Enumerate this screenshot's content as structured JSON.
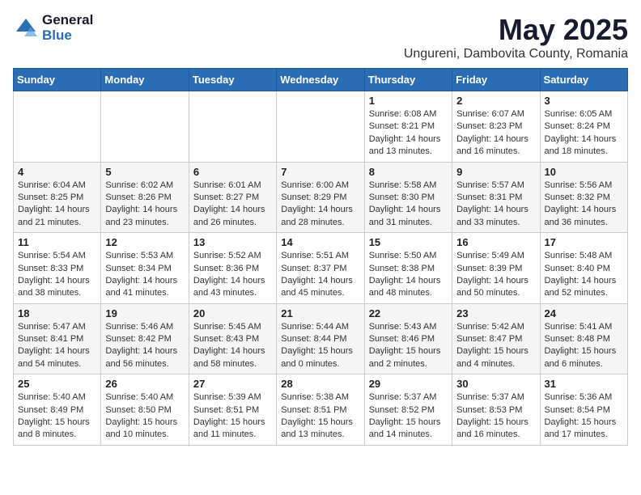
{
  "header": {
    "logo_general": "General",
    "logo_blue": "Blue",
    "month_title": "May 2025",
    "location": "Ungureni, Dambovita County, Romania"
  },
  "days_of_week": [
    "Sunday",
    "Monday",
    "Tuesday",
    "Wednesday",
    "Thursday",
    "Friday",
    "Saturday"
  ],
  "weeks": [
    [
      {
        "num": "",
        "info": ""
      },
      {
        "num": "",
        "info": ""
      },
      {
        "num": "",
        "info": ""
      },
      {
        "num": "",
        "info": ""
      },
      {
        "num": "1",
        "info": "Sunrise: 6:08 AM\nSunset: 8:21 PM\nDaylight: 14 hours\nand 13 minutes."
      },
      {
        "num": "2",
        "info": "Sunrise: 6:07 AM\nSunset: 8:23 PM\nDaylight: 14 hours\nand 16 minutes."
      },
      {
        "num": "3",
        "info": "Sunrise: 6:05 AM\nSunset: 8:24 PM\nDaylight: 14 hours\nand 18 minutes."
      }
    ],
    [
      {
        "num": "4",
        "info": "Sunrise: 6:04 AM\nSunset: 8:25 PM\nDaylight: 14 hours\nand 21 minutes."
      },
      {
        "num": "5",
        "info": "Sunrise: 6:02 AM\nSunset: 8:26 PM\nDaylight: 14 hours\nand 23 minutes."
      },
      {
        "num": "6",
        "info": "Sunrise: 6:01 AM\nSunset: 8:27 PM\nDaylight: 14 hours\nand 26 minutes."
      },
      {
        "num": "7",
        "info": "Sunrise: 6:00 AM\nSunset: 8:29 PM\nDaylight: 14 hours\nand 28 minutes."
      },
      {
        "num": "8",
        "info": "Sunrise: 5:58 AM\nSunset: 8:30 PM\nDaylight: 14 hours\nand 31 minutes."
      },
      {
        "num": "9",
        "info": "Sunrise: 5:57 AM\nSunset: 8:31 PM\nDaylight: 14 hours\nand 33 minutes."
      },
      {
        "num": "10",
        "info": "Sunrise: 5:56 AM\nSunset: 8:32 PM\nDaylight: 14 hours\nand 36 minutes."
      }
    ],
    [
      {
        "num": "11",
        "info": "Sunrise: 5:54 AM\nSunset: 8:33 PM\nDaylight: 14 hours\nand 38 minutes."
      },
      {
        "num": "12",
        "info": "Sunrise: 5:53 AM\nSunset: 8:34 PM\nDaylight: 14 hours\nand 41 minutes."
      },
      {
        "num": "13",
        "info": "Sunrise: 5:52 AM\nSunset: 8:36 PM\nDaylight: 14 hours\nand 43 minutes."
      },
      {
        "num": "14",
        "info": "Sunrise: 5:51 AM\nSunset: 8:37 PM\nDaylight: 14 hours\nand 45 minutes."
      },
      {
        "num": "15",
        "info": "Sunrise: 5:50 AM\nSunset: 8:38 PM\nDaylight: 14 hours\nand 48 minutes."
      },
      {
        "num": "16",
        "info": "Sunrise: 5:49 AM\nSunset: 8:39 PM\nDaylight: 14 hours\nand 50 minutes."
      },
      {
        "num": "17",
        "info": "Sunrise: 5:48 AM\nSunset: 8:40 PM\nDaylight: 14 hours\nand 52 minutes."
      }
    ],
    [
      {
        "num": "18",
        "info": "Sunrise: 5:47 AM\nSunset: 8:41 PM\nDaylight: 14 hours\nand 54 minutes."
      },
      {
        "num": "19",
        "info": "Sunrise: 5:46 AM\nSunset: 8:42 PM\nDaylight: 14 hours\nand 56 minutes."
      },
      {
        "num": "20",
        "info": "Sunrise: 5:45 AM\nSunset: 8:43 PM\nDaylight: 14 hours\nand 58 minutes."
      },
      {
        "num": "21",
        "info": "Sunrise: 5:44 AM\nSunset: 8:44 PM\nDaylight: 15 hours\nand 0 minutes."
      },
      {
        "num": "22",
        "info": "Sunrise: 5:43 AM\nSunset: 8:46 PM\nDaylight: 15 hours\nand 2 minutes."
      },
      {
        "num": "23",
        "info": "Sunrise: 5:42 AM\nSunset: 8:47 PM\nDaylight: 15 hours\nand 4 minutes."
      },
      {
        "num": "24",
        "info": "Sunrise: 5:41 AM\nSunset: 8:48 PM\nDaylight: 15 hours\nand 6 minutes."
      }
    ],
    [
      {
        "num": "25",
        "info": "Sunrise: 5:40 AM\nSunset: 8:49 PM\nDaylight: 15 hours\nand 8 minutes."
      },
      {
        "num": "26",
        "info": "Sunrise: 5:40 AM\nSunset: 8:50 PM\nDaylight: 15 hours\nand 10 minutes."
      },
      {
        "num": "27",
        "info": "Sunrise: 5:39 AM\nSunset: 8:51 PM\nDaylight: 15 hours\nand 11 minutes."
      },
      {
        "num": "28",
        "info": "Sunrise: 5:38 AM\nSunset: 8:51 PM\nDaylight: 15 hours\nand 13 minutes."
      },
      {
        "num": "29",
        "info": "Sunrise: 5:37 AM\nSunset: 8:52 PM\nDaylight: 15 hours\nand 14 minutes."
      },
      {
        "num": "30",
        "info": "Sunrise: 5:37 AM\nSunset: 8:53 PM\nDaylight: 15 hours\nand 16 minutes."
      },
      {
        "num": "31",
        "info": "Sunrise: 5:36 AM\nSunset: 8:54 PM\nDaylight: 15 hours\nand 17 minutes."
      }
    ]
  ]
}
